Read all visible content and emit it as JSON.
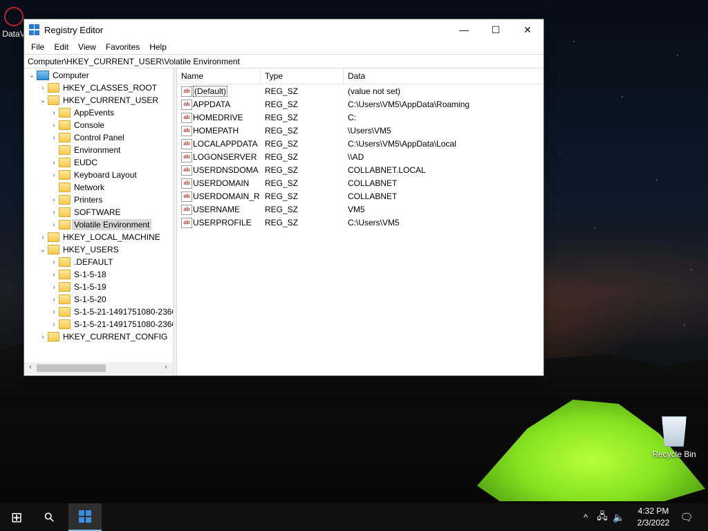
{
  "desktop": {
    "top_left_icon_label": "DataV",
    "recycle_bin_label": "Recycle Bin"
  },
  "window": {
    "title": "Registry Editor",
    "minimize_glyph": "—",
    "maximize_glyph": "☐",
    "close_glyph": "✕"
  },
  "menu": [
    "File",
    "Edit",
    "View",
    "Favorites",
    "Help"
  ],
  "address": "Computer\\HKEY_CURRENT_USER\\Volatile Environment",
  "tree": [
    {
      "label": "Computer",
      "caret": "⌄",
      "icon": "computer",
      "level": 0
    },
    {
      "label": "HKEY_CLASSES_ROOT",
      "caret": "›",
      "icon": "folder",
      "level": 1
    },
    {
      "label": "HKEY_CURRENT_USER",
      "caret": "⌄",
      "icon": "folder",
      "level": 1
    },
    {
      "label": "AppEvents",
      "caret": "›",
      "icon": "folder",
      "level": 2
    },
    {
      "label": "Console",
      "caret": "›",
      "icon": "folder",
      "level": 2
    },
    {
      "label": "Control Panel",
      "caret": "›",
      "icon": "folder",
      "level": 2
    },
    {
      "label": "Environment",
      "caret": "",
      "icon": "folder",
      "level": 2
    },
    {
      "label": "EUDC",
      "caret": "›",
      "icon": "folder",
      "level": 2
    },
    {
      "label": "Keyboard Layout",
      "caret": "›",
      "icon": "folder",
      "level": 2
    },
    {
      "label": "Network",
      "caret": "",
      "icon": "folder",
      "level": 2
    },
    {
      "label": "Printers",
      "caret": "›",
      "icon": "folder",
      "level": 2
    },
    {
      "label": "SOFTWARE",
      "caret": "›",
      "icon": "folder",
      "level": 2
    },
    {
      "label": "Volatile Environment",
      "caret": "›",
      "icon": "folder",
      "level": 2,
      "selected": true
    },
    {
      "label": "HKEY_LOCAL_MACHINE",
      "caret": "›",
      "icon": "folder",
      "level": 1
    },
    {
      "label": "HKEY_USERS",
      "caret": "⌄",
      "icon": "folder",
      "level": 1
    },
    {
      "label": ".DEFAULT",
      "caret": "›",
      "icon": "folder",
      "level": 2
    },
    {
      "label": "S-1-5-18",
      "caret": "›",
      "icon": "folder",
      "level": 2
    },
    {
      "label": "S-1-5-19",
      "caret": "›",
      "icon": "folder",
      "level": 2
    },
    {
      "label": "S-1-5-20",
      "caret": "›",
      "icon": "folder",
      "level": 2
    },
    {
      "label": "S-1-5-21-1491751080-2360",
      "caret": "›",
      "icon": "folder",
      "level": 2
    },
    {
      "label": "S-1-5-21-1491751080-2360",
      "caret": "›",
      "icon": "folder",
      "level": 2
    },
    {
      "label": "HKEY_CURRENT_CONFIG",
      "caret": "›",
      "icon": "folder",
      "level": 1
    }
  ],
  "tree_scroll": {
    "left_arrow": "‹",
    "right_arrow": "›"
  },
  "values": {
    "columns": {
      "name": "Name",
      "type": "Type",
      "data": "Data"
    },
    "icon_text": "ab",
    "rows": [
      {
        "name": "(Default)",
        "type": "REG_SZ",
        "data": "(value not set)"
      },
      {
        "name": "APPDATA",
        "type": "REG_SZ",
        "data": "C:\\Users\\VM5\\AppData\\Roaming"
      },
      {
        "name": "HOMEDRIVE",
        "type": "REG_SZ",
        "data": "C:"
      },
      {
        "name": "HOMEPATH",
        "type": "REG_SZ",
        "data": "\\Users\\VM5"
      },
      {
        "name": "LOCALAPPDATA",
        "type": "REG_SZ",
        "data": "C:\\Users\\VM5\\AppData\\Local"
      },
      {
        "name": "LOGONSERVER",
        "type": "REG_SZ",
        "data": "\\\\AD"
      },
      {
        "name": "USERDNSDOMA...",
        "type": "REG_SZ",
        "data": "COLLABNET.LOCAL"
      },
      {
        "name": "USERDOMAIN",
        "type": "REG_SZ",
        "data": "COLLABNET"
      },
      {
        "name": "USERDOMAIN_R...",
        "type": "REG_SZ",
        "data": "COLLABNET"
      },
      {
        "name": "USERNAME",
        "type": "REG_SZ",
        "data": "VM5"
      },
      {
        "name": "USERPROFILE",
        "type": "REG_SZ",
        "data": "C:\\Users\\VM5"
      }
    ]
  },
  "taskbar": {
    "start_glyph": "⊞",
    "search_glyph": "⚲",
    "tray_up_glyph": "^",
    "network_glyph": "🖧",
    "volume_glyph": "🔈",
    "notification_glyph": "🗨",
    "time": "4:32 PM",
    "date": "2/3/2022"
  }
}
